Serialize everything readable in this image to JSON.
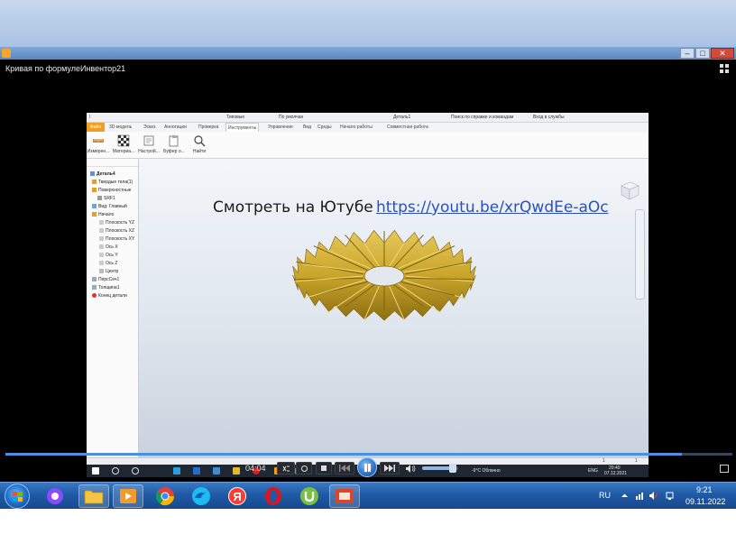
{
  "player": {
    "title": "Кривая по формулеИнвентор21",
    "time": "04:04",
    "progress_fraction": 0.93,
    "volume_fraction": 0.8
  },
  "video": {
    "link_label": "Смотреть на Ютубе",
    "link_url": "https://youtu.be/xrQwdEe-aOc",
    "inventor": {
      "quick_access_style": "Типовые",
      "quick_access_view": "По умолчан",
      "doc_title": "Деталь1",
      "search_placeholder": "Поиск по справке и командам",
      "signin": "Вход в службы",
      "tabs": [
        "3D-модель",
        "Эскиз",
        "Аннотации",
        "Проверка",
        "Инструменты",
        "Управление",
        "Вид",
        "Среды",
        "Начало работы",
        "Совместная работа"
      ],
      "file_tab": "Файл",
      "active_tab": "Инструменты",
      "ribbon_buttons": [
        "Измерен...",
        "Материа...",
        "Настрой...",
        "Буфер о...",
        "Найти"
      ],
      "tree": [
        "Деталь4",
        "Твердые тела(1)",
        "Поверхностные",
        "SRF1",
        "Вид: Главный",
        "Начало",
        "Плоскость YZ",
        "Плоскость XZ",
        "Плоскость XY",
        "Ось X",
        "Ось Y",
        "Ось Z",
        "Центр",
        "ПерсСеч1",
        "Толщина1",
        "Конец детали"
      ],
      "status_left": "1",
      "status_right": "1",
      "taskbar_weather": "-9°C  Облачно",
      "taskbar_lang": "ENG",
      "taskbar_time": "20:40",
      "taskbar_date": "07.12.2021"
    }
  },
  "taskbar": {
    "lang": "RU",
    "time": "9:21",
    "date": "09.11.2022",
    "apps": [
      "start-orb",
      "alice",
      "explorer",
      "media-player",
      "chrome",
      "edge",
      "yandex-browser",
      "opera",
      "utorrent",
      "presentation"
    ]
  },
  "colors": {
    "slide_top": "#a9c2e4",
    "player_bg": "#000000",
    "accent": "#4a90e2",
    "gear": "#c9a52a",
    "link": "#2a4fc0"
  }
}
